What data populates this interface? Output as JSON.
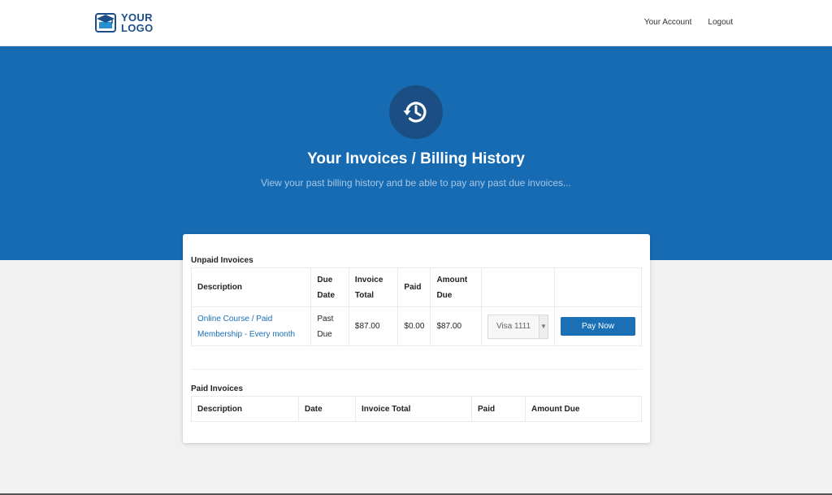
{
  "header": {
    "logo_line1": "YOUR",
    "logo_line2": "LOGO",
    "nav": {
      "account": "Your Account",
      "logout": "Logout"
    }
  },
  "hero": {
    "icon": "history-icon",
    "title": "Your Invoices / Billing History",
    "subtitle": "View your past billing history and be able to pay any past due invoices..."
  },
  "unpaid": {
    "title": "Unpaid Invoices",
    "headers": {
      "description": "Description",
      "due_date": "Due Date",
      "invoice_total": "Invoice Total",
      "paid": "Paid",
      "amount_due": "Amount Due"
    },
    "rows": [
      {
        "description": "Online Course / Paid Membership - Every month",
        "due_date": "Past Due",
        "invoice_total": "$87.00",
        "paid": "$0.00",
        "amount_due": "$87.00",
        "card": "Visa 1111",
        "button": "Pay Now"
      }
    ]
  },
  "paid": {
    "title": "Paid Invoices",
    "headers": {
      "description": "Description",
      "date": "Date",
      "invoice_total": "Invoice Total",
      "paid": "Paid",
      "amount_due": "Amount Due"
    }
  },
  "colors": {
    "hero": "#166bb3",
    "accent": "#1a6fb5",
    "icon_circle": "#1b4f84"
  }
}
